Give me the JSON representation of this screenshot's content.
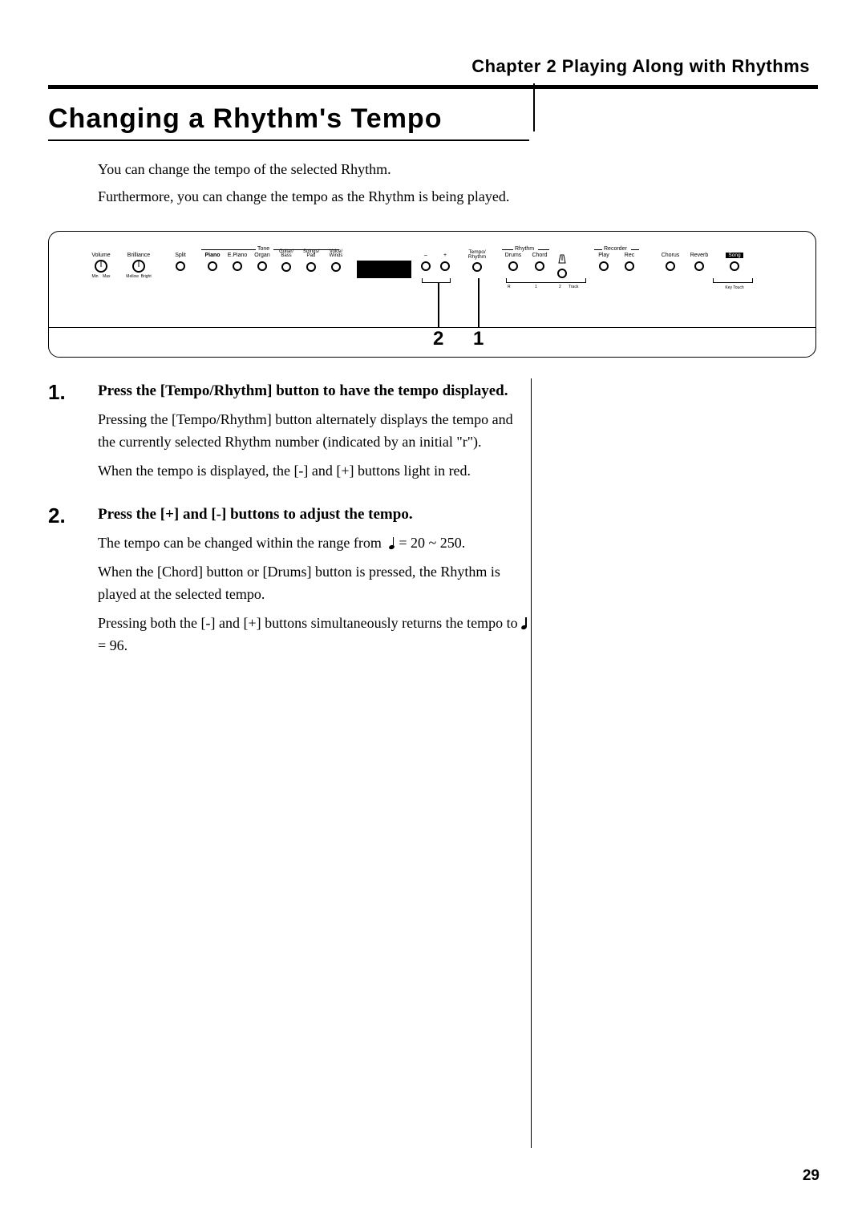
{
  "chapter": "Chapter 2 Playing Along with Rhythms",
  "title": "Changing a Rhythm's Tempo",
  "intro": [
    "You can change the tempo of the selected Rhythm.",
    "Furthermore, you can change the tempo as the Rhythm is being played."
  ],
  "panel": {
    "volume": "Volume",
    "brilliance": "Brilliance",
    "min": "Min",
    "max": "Max",
    "mellow": "Mellow",
    "bright": "Bright",
    "split": "Split",
    "tone_group": "Tone",
    "tones": [
      "Piano",
      "E.Piano",
      "Organ",
      "Guitar/\nBass",
      "Strings/\nPad",
      "Voice/\nWinds"
    ],
    "minus": "–",
    "plus": "+",
    "tempo_rhythm": "Tempo/\nRhythm",
    "rhythm_group": "Rhythm",
    "drums": "Drums",
    "chord": "Chord",
    "recorder_group": "Recorder",
    "play": "Play",
    "rec": "Rec",
    "chorus": "Chorus",
    "reverb": "Reverb",
    "song": "Song",
    "track": "Track",
    "track_r": "R",
    "track_1": "1",
    "track_2": "2",
    "key_touch": "Key Touch",
    "callout_1": "1",
    "callout_2": "2"
  },
  "steps": [
    {
      "no": "1.",
      "head": "Press the [Tempo/Rhythm] button to have the tempo displayed.",
      "paras": [
        "Pressing the [Tempo/Rhythm] button alternately displays the tempo and the currently selected Rhythm number (indicated by an initial \"r\").",
        "When the tempo is displayed, the [-] and [+] buttons light in red."
      ]
    },
    {
      "no": "2.",
      "head": "Press the [+] and [-] buttons to adjust the tempo.",
      "paras": [
        "The tempo can be changed within the range from  ♩ = 20 ~ 250.",
        "When the [Chord] button or [Drums] button is pressed, the Rhythm is played at the selected tempo.",
        "Pressing both the [-] and [+] buttons simultaneously returns the tempo to ♩ = 96."
      ]
    }
  ],
  "page_number": "29"
}
